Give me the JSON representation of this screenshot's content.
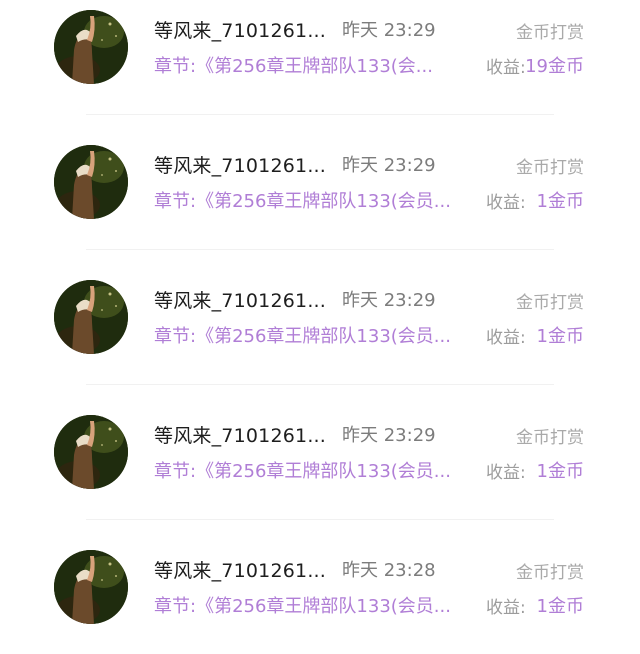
{
  "records": [
    {
      "name": "等风来_7101261...",
      "time": "昨天 23:29",
      "tag": "金币打赏",
      "chapter": "章节:《第256章王牌部队133(会...",
      "earn_label": "收益:",
      "earn_value": "19金币"
    },
    {
      "name": "等风来_7101261...",
      "time": "昨天 23:29",
      "tag": "金币打赏",
      "chapter": "章节:《第256章王牌部队133(会员...",
      "earn_label": "收益:",
      "earn_value": "1金币"
    },
    {
      "name": "等风来_7101261...",
      "time": "昨天 23:29",
      "tag": "金币打赏",
      "chapter": "章节:《第256章王牌部队133(会员...",
      "earn_label": "收益:",
      "earn_value": "1金币"
    },
    {
      "name": "等风来_7101261...",
      "time": "昨天 23:29",
      "tag": "金币打赏",
      "chapter": "章节:《第256章王牌部队133(会员...",
      "earn_label": "收益:",
      "earn_value": "1金币"
    },
    {
      "name": "等风来_7101261...",
      "time": "昨天 23:28",
      "tag": "金币打赏",
      "chapter": "章节:《第256章王牌部队133(会员...",
      "earn_label": "收益:",
      "earn_value": "1金币"
    }
  ],
  "colors": {
    "accent": "#b07ed6",
    "name": "#1e1e1e",
    "muted": "#a9a9a9"
  },
  "icons": {
    "avatar": "avatar-icon"
  }
}
